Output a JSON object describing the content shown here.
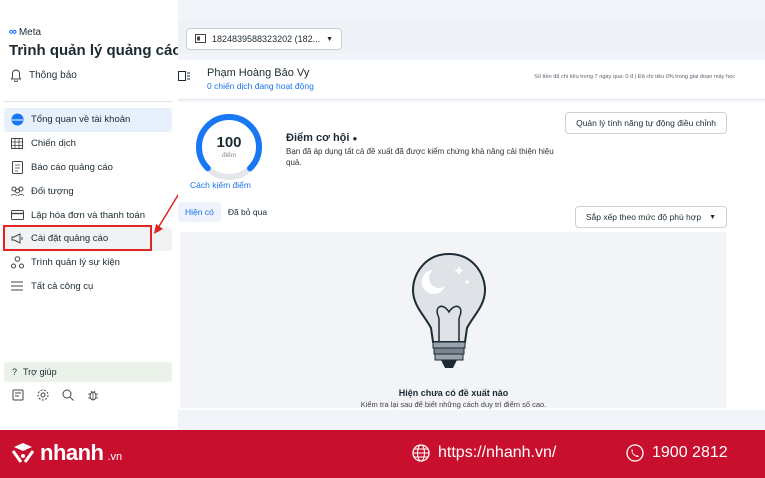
{
  "brand": {
    "name": "Meta",
    "app_title": "Trình quản lý quảng cáo"
  },
  "notifications": {
    "label": "Thông báo"
  },
  "nav": [
    {
      "label": "Tổng quan về tài khoản",
      "icon": "circle-filled-icon",
      "state": "active"
    },
    {
      "label": "Chiến dịch",
      "icon": "table-icon",
      "state": ""
    },
    {
      "label": "Báo cáo quảng cáo",
      "icon": "report-icon",
      "state": ""
    },
    {
      "label": "Đối tượng",
      "icon": "people-icon",
      "state": ""
    },
    {
      "label": "Lập hóa đơn và thanh toán",
      "icon": "card-icon",
      "state": ""
    },
    {
      "label": "Cài đặt quảng cáo",
      "icon": "megaphone-icon",
      "state": "hover"
    },
    {
      "label": "Trình quản lý sự kiện",
      "icon": "events-icon",
      "state": ""
    },
    {
      "label": "Tất cả công cụ",
      "icon": "menu-icon",
      "state": ""
    }
  ],
  "help": {
    "label": "Trợ giúp"
  },
  "account": {
    "selector": "1824839588323202 (182...",
    "name": "Phạm Hoàng Bảo Vy",
    "sub": "0 chiến dịch đang hoạt động",
    "spend": "Số tiền đã chi tiêu trong 7 ngày qua: 0 đ | Đã chi tiêu 0% trong giai đoạn máy học"
  },
  "opportunity": {
    "score": "100",
    "unit": "điểm",
    "score_percent": 100,
    "link": "Cách kiếm điểm",
    "title": "Điểm cơ hội",
    "desc": "Bạn đã áp dụng tất cả đề xuất đã được kiểm chứng khả năng cải thiện hiệu quả.",
    "auto_button": "Quản lý tính năng tự động điều chỉnh"
  },
  "tabs": [
    "Hiện có",
    "Đã bỏ qua"
  ],
  "sort": "Sắp xếp theo mức độ phù hợp",
  "empty": {
    "title": "Hiện chưa có đề xuất nào",
    "sub": "Kiểm tra lại sau để biết những cách duy trì điểm số cao."
  },
  "banner": {
    "logo": "nhanh",
    "logo_suffix": ".vn",
    "url": "https://nhanh.vn/",
    "phone": "1900 2812"
  },
  "colors": {
    "accent": "#0866ff",
    "banner": "#c8102e",
    "highlight": "#e02424"
  }
}
